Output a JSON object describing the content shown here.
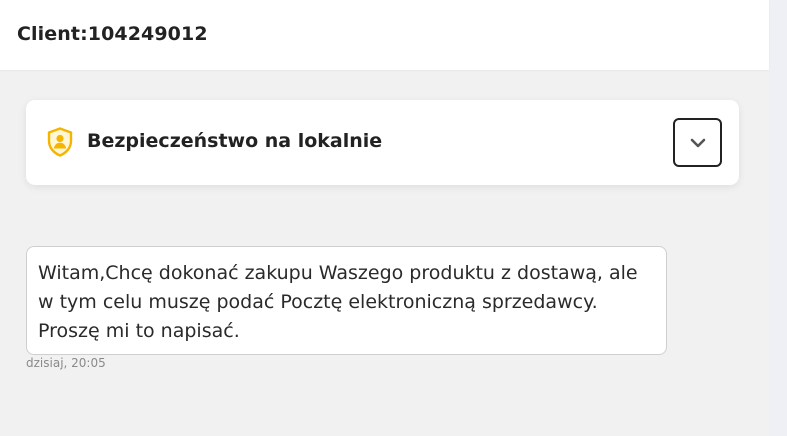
{
  "header": {
    "client_label": "Client:104249012"
  },
  "security_card": {
    "title": "Bezpieczeństwo na lokalnie",
    "icon": "shield-user-icon",
    "expand_icon": "chevron-down-icon",
    "accent_color": "#f5b400"
  },
  "messages": [
    {
      "text": "Witam,Chcę dokonać zakupu Waszego produktu z dostawą, ale w tym celu muszę podać Pocztę elektroniczną sprzedawcy. Proszę mi to napisać.",
      "time": "dzisiaj, 20:05"
    }
  ]
}
